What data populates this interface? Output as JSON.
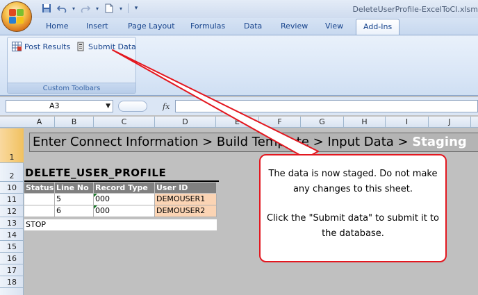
{
  "window": {
    "title": "DeleteUserProfile-ExcelToCI.xlsm"
  },
  "ribbon": {
    "tabs": [
      {
        "label": "Home"
      },
      {
        "label": "Insert"
      },
      {
        "label": "Page Layout"
      },
      {
        "label": "Formulas"
      },
      {
        "label": "Data"
      },
      {
        "label": "Review"
      },
      {
        "label": "View"
      },
      {
        "label": "Add-Ins",
        "active": true
      }
    ],
    "group": {
      "label": "Custom Toolbars",
      "buttons": [
        {
          "label": "Post Results",
          "icon": "post-results-icon"
        },
        {
          "label": "Submit Data",
          "icon": "submit-data-icon"
        }
      ]
    }
  },
  "formula_bar": {
    "name_box": "A3",
    "fx_label": "fx",
    "formula": ""
  },
  "grid": {
    "columns": [
      "A",
      "B",
      "C",
      "D",
      "E",
      "F",
      "G",
      "H",
      "I",
      "J"
    ],
    "rows": [
      "1",
      "2",
      "10",
      "11",
      "12",
      "13",
      "14",
      "15",
      "16",
      "17",
      "18"
    ],
    "selected_row": "1"
  },
  "sheet": {
    "banner_prefix": "Enter Connect Information > Build Template > Input Data > ",
    "banner_current": "Staging",
    "title": "DELETE_USER_PROFILE",
    "headers": [
      "Status",
      "Line No",
      "Record Type",
      "User ID"
    ],
    "rows": [
      {
        "status": "",
        "line_no": "5",
        "record_type": "000",
        "user_id": "DEMOUSER1"
      },
      {
        "status": "",
        "line_no": "6",
        "record_type": "000",
        "user_id": "DEMOUSER2"
      }
    ],
    "stop_label": "STOP"
  },
  "callout": {
    "line1": "The data is now staged. Do not make any changes to this sheet.",
    "line2": "Click the \"Submit data\" to submit it to the database.",
    "border_color": "#e3171f"
  }
}
